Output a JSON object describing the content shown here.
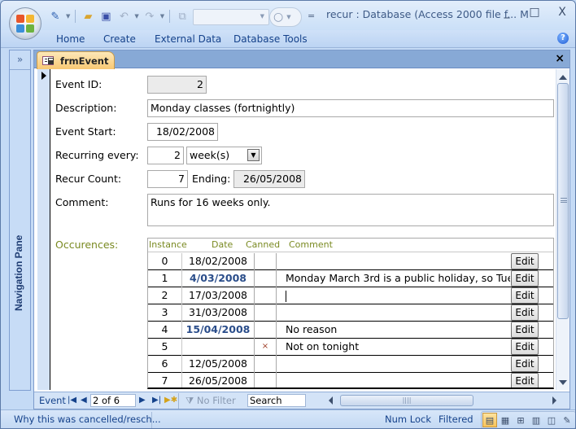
{
  "window": {
    "title": "recur : Database (Access 2000 file f... M",
    "controls": {
      "minimize": "_",
      "maximize": "□",
      "close": "X"
    }
  },
  "quick_access": {
    "icons": [
      "design-icon",
      "open-folder-icon",
      "save-icon",
      "undo-icon",
      "redo-icon",
      "object-icon"
    ],
    "more": "="
  },
  "ribbon": {
    "tabs": [
      {
        "label": "Home"
      },
      {
        "label": "Create"
      },
      {
        "label": "External Data"
      },
      {
        "label": "Database Tools"
      }
    ],
    "help": "?"
  },
  "nav_pane": {
    "toggle": "»",
    "label": "Navigation Pane"
  },
  "document": {
    "tab_label": "frmEvent",
    "close": "×"
  },
  "form": {
    "event_id": {
      "label": "Event ID:",
      "value": "2"
    },
    "description": {
      "label": "Description:",
      "value": "Monday classes (fortnightly)"
    },
    "event_start": {
      "label": "Event Start:",
      "value": "18/02/2008"
    },
    "recurring_every": {
      "label": "Recurring every:",
      "value": "2",
      "unit": "week(s)"
    },
    "recur_count": {
      "label": "Recur Count:",
      "value": "7"
    },
    "ending": {
      "label": "Ending:",
      "value": "26/05/2008"
    },
    "comment": {
      "label": "Comment:",
      "value": "Runs for 16 weeks only."
    },
    "occurrences_label": "Occurences:"
  },
  "occurrences": {
    "headers": {
      "instance": "Instance",
      "date": "Date",
      "canned": "Canned",
      "comment": "Comment"
    },
    "edit_label": "Edit",
    "rows": [
      {
        "instance": "0",
        "date": "18/02/2008",
        "bold": false,
        "canned": "",
        "comment": ""
      },
      {
        "instance": "1",
        "date": "4/03/2008",
        "bold": true,
        "canned": "",
        "comment": "Monday March 3rd is a public holiday, so Tue"
      },
      {
        "instance": "2",
        "date": "17/03/2008",
        "bold": false,
        "canned": "",
        "comment": "",
        "editing": true
      },
      {
        "instance": "3",
        "date": "31/03/2008",
        "bold": false,
        "canned": "",
        "comment": ""
      },
      {
        "instance": "4",
        "date": "15/04/2008",
        "bold": true,
        "canned": "",
        "comment": "No reason"
      },
      {
        "instance": "5",
        "date": "",
        "bold": false,
        "canned": "×",
        "comment": "Not on tonight"
      },
      {
        "instance": "6",
        "date": "12/05/2008",
        "bold": false,
        "canned": "",
        "comment": ""
      },
      {
        "instance": "7",
        "date": "26/05/2008",
        "bold": false,
        "canned": "",
        "comment": ""
      }
    ]
  },
  "record_nav": {
    "label": "Event",
    "record": "2 of 6",
    "filter": "No Filter",
    "search": "Search"
  },
  "status_bar": {
    "text": "Why this was cancelled/resch...",
    "num_lock": "Num Lock",
    "filtered": "Filtered",
    "views": [
      "form-view-icon",
      "datasheet-view-icon",
      "pivottable-view-icon",
      "pivotchart-view-icon",
      "layout-view-icon",
      "design-view-icon"
    ]
  }
}
